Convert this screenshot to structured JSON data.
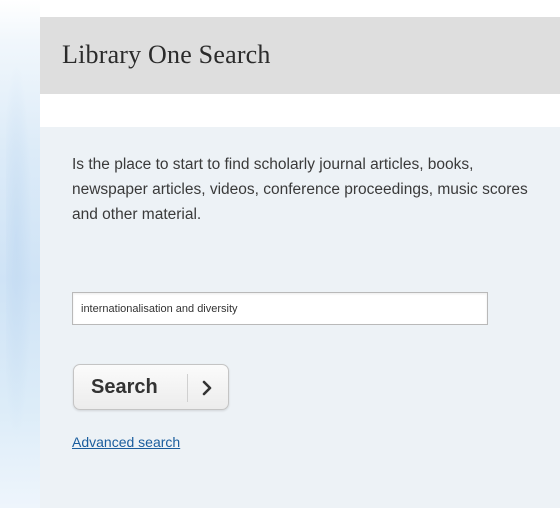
{
  "header": {
    "title": "Library One Search"
  },
  "panel": {
    "description": "Is the place to start to find scholarly journal articles, books, newspaper articles, videos, conference proceedings, music scores and other material."
  },
  "search": {
    "value": "internationalisation and diversity",
    "button_label": "Search",
    "button_icon": "chevron-right-icon"
  },
  "links": {
    "advanced_search": "Advanced search"
  },
  "colors": {
    "header_bg": "#dedede",
    "panel_bg": "#edf2f6",
    "link": "#1a5d9e",
    "text": "#3a3a3a"
  }
}
